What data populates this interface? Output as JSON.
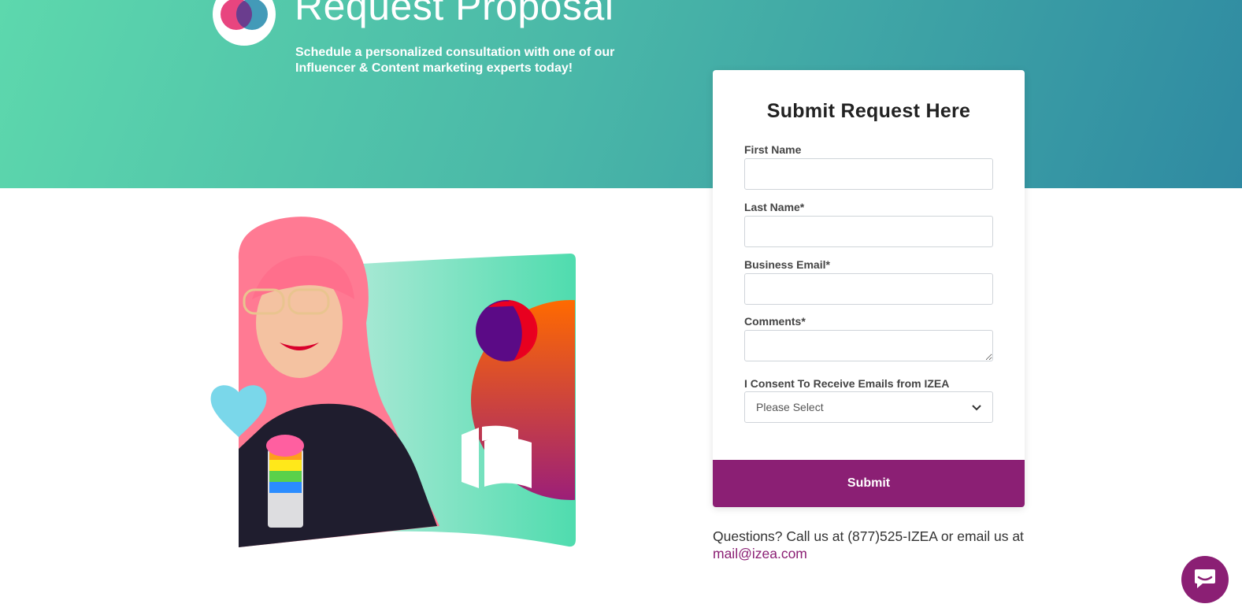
{
  "hero": {
    "title": "Request Proposal",
    "subtitle": "Schedule a personalized consultation with one of our Influencer & Content marketing experts today!"
  },
  "form": {
    "title": "Submit Request Here",
    "fields": [
      {
        "label": "First Name",
        "value": ""
      },
      {
        "label": "Last Name*",
        "value": ""
      },
      {
        "label": "Business Email*",
        "value": ""
      },
      {
        "label": "Comments*",
        "value": ""
      }
    ],
    "consent": {
      "label": "I Consent To Receive Emails from IZEA",
      "selected": "Please Select"
    },
    "submit_label": "Submit"
  },
  "contact": {
    "text": "Questions? Call us at (877)525-IZEA or email us at ",
    "email": "mail@izea.com"
  },
  "colors": {
    "brand_purple": "#8b1f74",
    "hero_green": "#5dd8ad",
    "hero_teal": "#2f8aa2"
  },
  "icons": {
    "logo": "izea-venn-logo-icon",
    "chat": "chat-bubble-icon",
    "select_caret": "chevron-down-icon"
  }
}
